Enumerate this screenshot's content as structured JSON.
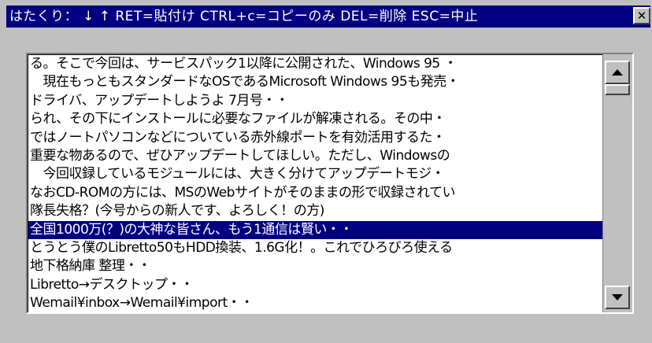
{
  "window": {
    "title": "はたくり： ↓ ↑  RET=貼付け  CTRL+c=コピーのみ  DEL=削除  ESC=中止",
    "close_label": "✕"
  },
  "list": {
    "items": [
      "る。そこで今回は、サービスパック1以降に公開された、Windows 95 ・",
      "　現在もっともスタンダードなOSであるMicrosoft Windows 95も発売・",
      "ドライバ、アップデートしようよ 7月号・・",
      "られ、その下にインストールに必要なファイルが解凍される。その中・",
      "ではノートパソコンなどについている赤外線ポートを有効活用するた・",
      "重要な物あるので、ぜひアップデートしてほしい。ただし、Windowsの",
      "　今回収録しているモジュールには、大きく分けてアップデートモジ・",
      "なおCD-ROMの方には、MSのWebサイトがそのままの形で収録されてい",
      "隊長失格？(今号からの新人です、よろしく！の方)",
      "全国1000万(？)の大神な皆さん、もう1通信は賢い・・",
      "とうとう僕のLibretto50もHDD換装、1.6G化！。これでひろびろ使える",
      "地下格納庫 整理・・",
      "Libretto→デスクトップ・・",
      "Wemail¥inbox→Wemail¥import・・"
    ],
    "selected_index": 9
  },
  "colors": {
    "titlebar": "#000080",
    "selection": "#000080",
    "face": "#c0c0c0"
  }
}
